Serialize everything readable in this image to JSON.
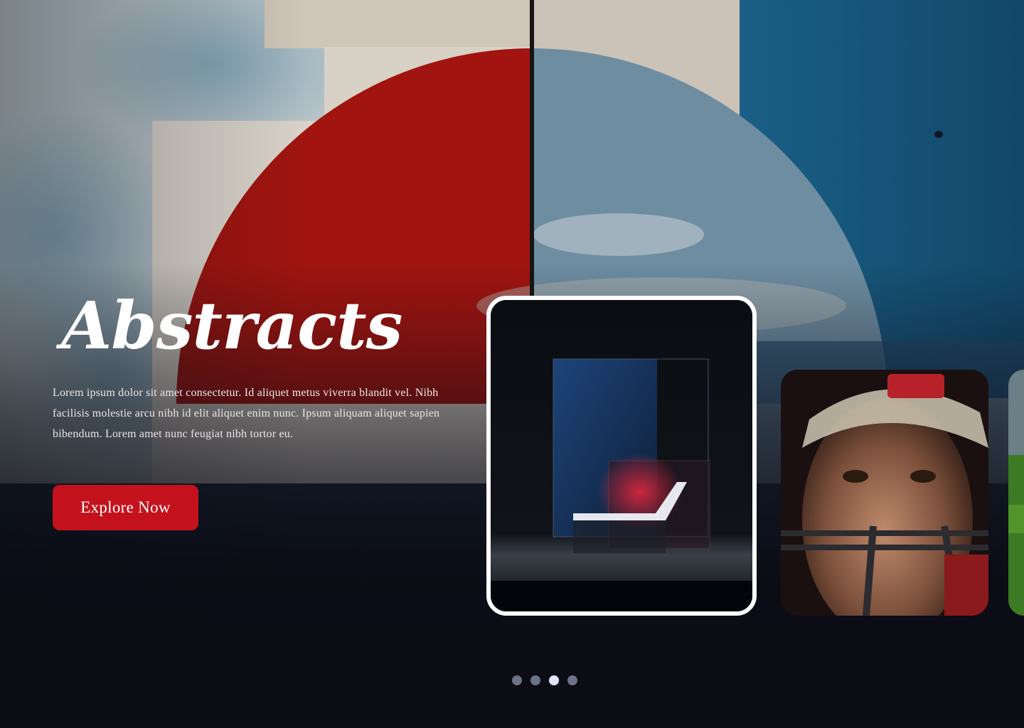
{
  "hero": {
    "title": "Abstracts",
    "description": "Lorem ipsum dolor sit amet consectetur. Id aliquet metus viverra blandit vel. Nibh facilisis molestie arcu nibh id elit aliquet enim nunc. Ipsum aliquam aliquet sapien bibendum. Lorem amet nunc feugiat nibh tortor eu.",
    "cta_label": "Explore Now",
    "accent_color": "#c4121d",
    "background_color": "#0b0c14"
  },
  "carousel": {
    "cards": [
      {
        "subject": "abstract-chair-render",
        "active": true
      },
      {
        "subject": "football-player-portrait",
        "active": false
      },
      {
        "subject": "green-landscape",
        "active": false
      }
    ],
    "pagination": {
      "total": 4,
      "active_index": 2,
      "dot_color": "#6d7387",
      "active_dot_color": "#e2e6f6"
    }
  }
}
